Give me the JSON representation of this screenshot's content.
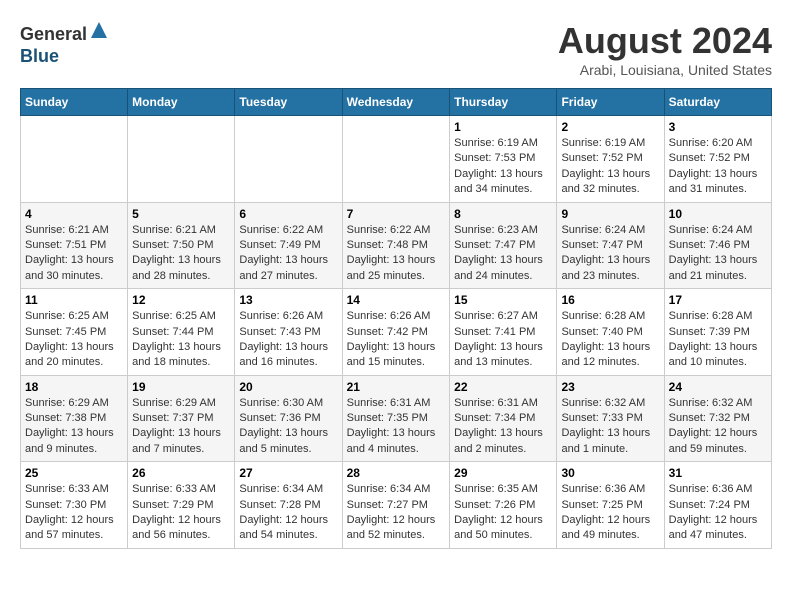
{
  "logo": {
    "general": "General",
    "blue": "Blue"
  },
  "title": {
    "month_year": "August 2024",
    "location": "Arabi, Louisiana, United States"
  },
  "header_days": [
    "Sunday",
    "Monday",
    "Tuesday",
    "Wednesday",
    "Thursday",
    "Friday",
    "Saturday"
  ],
  "weeks": [
    [
      {
        "day": "",
        "info": ""
      },
      {
        "day": "",
        "info": ""
      },
      {
        "day": "",
        "info": ""
      },
      {
        "day": "",
        "info": ""
      },
      {
        "day": "1",
        "info": "Sunrise: 6:19 AM\nSunset: 7:53 PM\nDaylight: 13 hours\nand 34 minutes."
      },
      {
        "day": "2",
        "info": "Sunrise: 6:19 AM\nSunset: 7:52 PM\nDaylight: 13 hours\nand 32 minutes."
      },
      {
        "day": "3",
        "info": "Sunrise: 6:20 AM\nSunset: 7:52 PM\nDaylight: 13 hours\nand 31 minutes."
      }
    ],
    [
      {
        "day": "4",
        "info": "Sunrise: 6:21 AM\nSunset: 7:51 PM\nDaylight: 13 hours\nand 30 minutes."
      },
      {
        "day": "5",
        "info": "Sunrise: 6:21 AM\nSunset: 7:50 PM\nDaylight: 13 hours\nand 28 minutes."
      },
      {
        "day": "6",
        "info": "Sunrise: 6:22 AM\nSunset: 7:49 PM\nDaylight: 13 hours\nand 27 minutes."
      },
      {
        "day": "7",
        "info": "Sunrise: 6:22 AM\nSunset: 7:48 PM\nDaylight: 13 hours\nand 25 minutes."
      },
      {
        "day": "8",
        "info": "Sunrise: 6:23 AM\nSunset: 7:47 PM\nDaylight: 13 hours\nand 24 minutes."
      },
      {
        "day": "9",
        "info": "Sunrise: 6:24 AM\nSunset: 7:47 PM\nDaylight: 13 hours\nand 23 minutes."
      },
      {
        "day": "10",
        "info": "Sunrise: 6:24 AM\nSunset: 7:46 PM\nDaylight: 13 hours\nand 21 minutes."
      }
    ],
    [
      {
        "day": "11",
        "info": "Sunrise: 6:25 AM\nSunset: 7:45 PM\nDaylight: 13 hours\nand 20 minutes."
      },
      {
        "day": "12",
        "info": "Sunrise: 6:25 AM\nSunset: 7:44 PM\nDaylight: 13 hours\nand 18 minutes."
      },
      {
        "day": "13",
        "info": "Sunrise: 6:26 AM\nSunset: 7:43 PM\nDaylight: 13 hours\nand 16 minutes."
      },
      {
        "day": "14",
        "info": "Sunrise: 6:26 AM\nSunset: 7:42 PM\nDaylight: 13 hours\nand 15 minutes."
      },
      {
        "day": "15",
        "info": "Sunrise: 6:27 AM\nSunset: 7:41 PM\nDaylight: 13 hours\nand 13 minutes."
      },
      {
        "day": "16",
        "info": "Sunrise: 6:28 AM\nSunset: 7:40 PM\nDaylight: 13 hours\nand 12 minutes."
      },
      {
        "day": "17",
        "info": "Sunrise: 6:28 AM\nSunset: 7:39 PM\nDaylight: 13 hours\nand 10 minutes."
      }
    ],
    [
      {
        "day": "18",
        "info": "Sunrise: 6:29 AM\nSunset: 7:38 PM\nDaylight: 13 hours\nand 9 minutes."
      },
      {
        "day": "19",
        "info": "Sunrise: 6:29 AM\nSunset: 7:37 PM\nDaylight: 13 hours\nand 7 minutes."
      },
      {
        "day": "20",
        "info": "Sunrise: 6:30 AM\nSunset: 7:36 PM\nDaylight: 13 hours\nand 5 minutes."
      },
      {
        "day": "21",
        "info": "Sunrise: 6:31 AM\nSunset: 7:35 PM\nDaylight: 13 hours\nand 4 minutes."
      },
      {
        "day": "22",
        "info": "Sunrise: 6:31 AM\nSunset: 7:34 PM\nDaylight: 13 hours\nand 2 minutes."
      },
      {
        "day": "23",
        "info": "Sunrise: 6:32 AM\nSunset: 7:33 PM\nDaylight: 13 hours\nand 1 minute."
      },
      {
        "day": "24",
        "info": "Sunrise: 6:32 AM\nSunset: 7:32 PM\nDaylight: 12 hours\nand 59 minutes."
      }
    ],
    [
      {
        "day": "25",
        "info": "Sunrise: 6:33 AM\nSunset: 7:30 PM\nDaylight: 12 hours\nand 57 minutes."
      },
      {
        "day": "26",
        "info": "Sunrise: 6:33 AM\nSunset: 7:29 PM\nDaylight: 12 hours\nand 56 minutes."
      },
      {
        "day": "27",
        "info": "Sunrise: 6:34 AM\nSunset: 7:28 PM\nDaylight: 12 hours\nand 54 minutes."
      },
      {
        "day": "28",
        "info": "Sunrise: 6:34 AM\nSunset: 7:27 PM\nDaylight: 12 hours\nand 52 minutes."
      },
      {
        "day": "29",
        "info": "Sunrise: 6:35 AM\nSunset: 7:26 PM\nDaylight: 12 hours\nand 50 minutes."
      },
      {
        "day": "30",
        "info": "Sunrise: 6:36 AM\nSunset: 7:25 PM\nDaylight: 12 hours\nand 49 minutes."
      },
      {
        "day": "31",
        "info": "Sunrise: 6:36 AM\nSunset: 7:24 PM\nDaylight: 12 hours\nand 47 minutes."
      }
    ]
  ]
}
